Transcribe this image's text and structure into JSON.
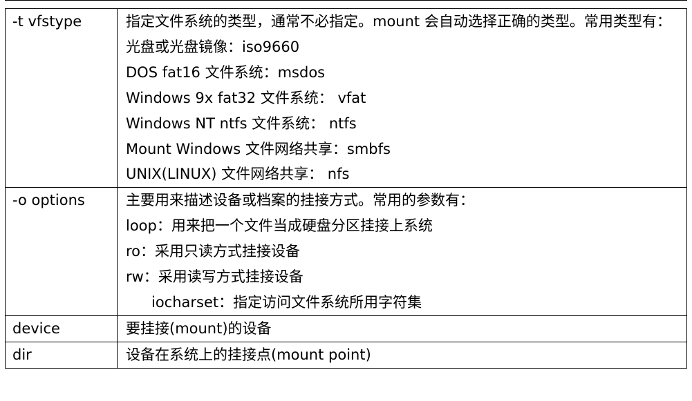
{
  "table": {
    "rows": [
      {
        "option": "-t vfstype",
        "lines": [
          "指定文件系统的类型，通常不必指定。mount 会自动选择正确的类型。常用类型有：",
          "光盘或光盘镜像：iso9660",
          "DOS fat16 文件系统：msdos",
          "Windows 9x fat32 文件系统： vfat",
          "Windows NT ntfs 文件系统： ntfs",
          "Mount Windows 文件网络共享：smbfs",
          "UNIX(LINUX) 文件网络共享： nfs"
        ]
      },
      {
        "option": "-o options",
        "lines": [
          "主要用来描述设备或档案的挂接方式。常用的参数有：",
          "loop：用来把一个文件当成硬盘分区挂接上系统",
          "ro：采用只读方式挂接设备",
          "rw：采用读写方式挂接设备",
          "iocharset：指定访问文件系统所用字符集"
        ]
      },
      {
        "option": "device",
        "lines": [
          "要挂接(mount)的设备"
        ]
      },
      {
        "option": "dir",
        "lines": [
          "设备在系统上的挂接点(mount point)"
        ]
      }
    ]
  }
}
